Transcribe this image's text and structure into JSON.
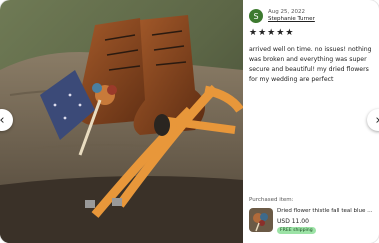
{
  "review": {
    "avatar_letter": "S",
    "avatar_color": "#3d7a2f",
    "date": "Aug 25, 2022",
    "reviewer_name": "Stephanie Turner",
    "rating": 5,
    "stars": [
      "★",
      "★",
      "★",
      "★",
      "★"
    ],
    "text": "arrived well on time. no issues! nothing was broken and everything was super secure and beautiful! my dried flowers for my wedding are perfect"
  },
  "purchased": {
    "label": "Purchased item:",
    "item_title": "Dried flower thistle fall teal blue burgundy boutonniere",
    "price": "USD 11.00",
    "badge": "FREE shipping",
    "badge_color": "#9ce3a6"
  },
  "carousel": {
    "prev_icon": "‹",
    "next_icon": "›"
  }
}
